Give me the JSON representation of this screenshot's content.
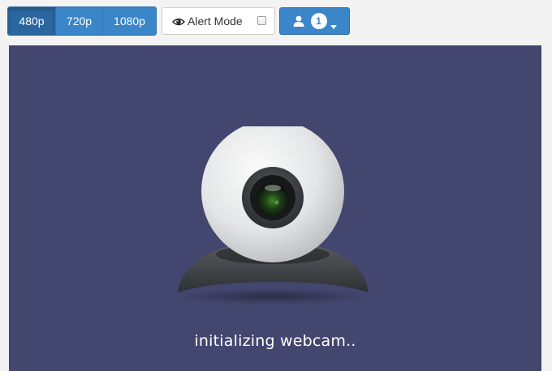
{
  "resolution": {
    "options": [
      {
        "label": "480p",
        "active": true
      },
      {
        "label": "720p",
        "active": false
      },
      {
        "label": "1080p",
        "active": false
      }
    ]
  },
  "alert_mode": {
    "label": "Alert Mode",
    "checked": false,
    "icon": "eye-icon"
  },
  "user_menu": {
    "icon": "user-icon",
    "count": "1",
    "caret": "caret-down-icon"
  },
  "video": {
    "status_text": "initializing webcam..",
    "background": "#43466e",
    "illustration": "webcam-icon"
  },
  "colors": {
    "primary": "#3a86c8",
    "primary_active": "#2a66a0"
  }
}
